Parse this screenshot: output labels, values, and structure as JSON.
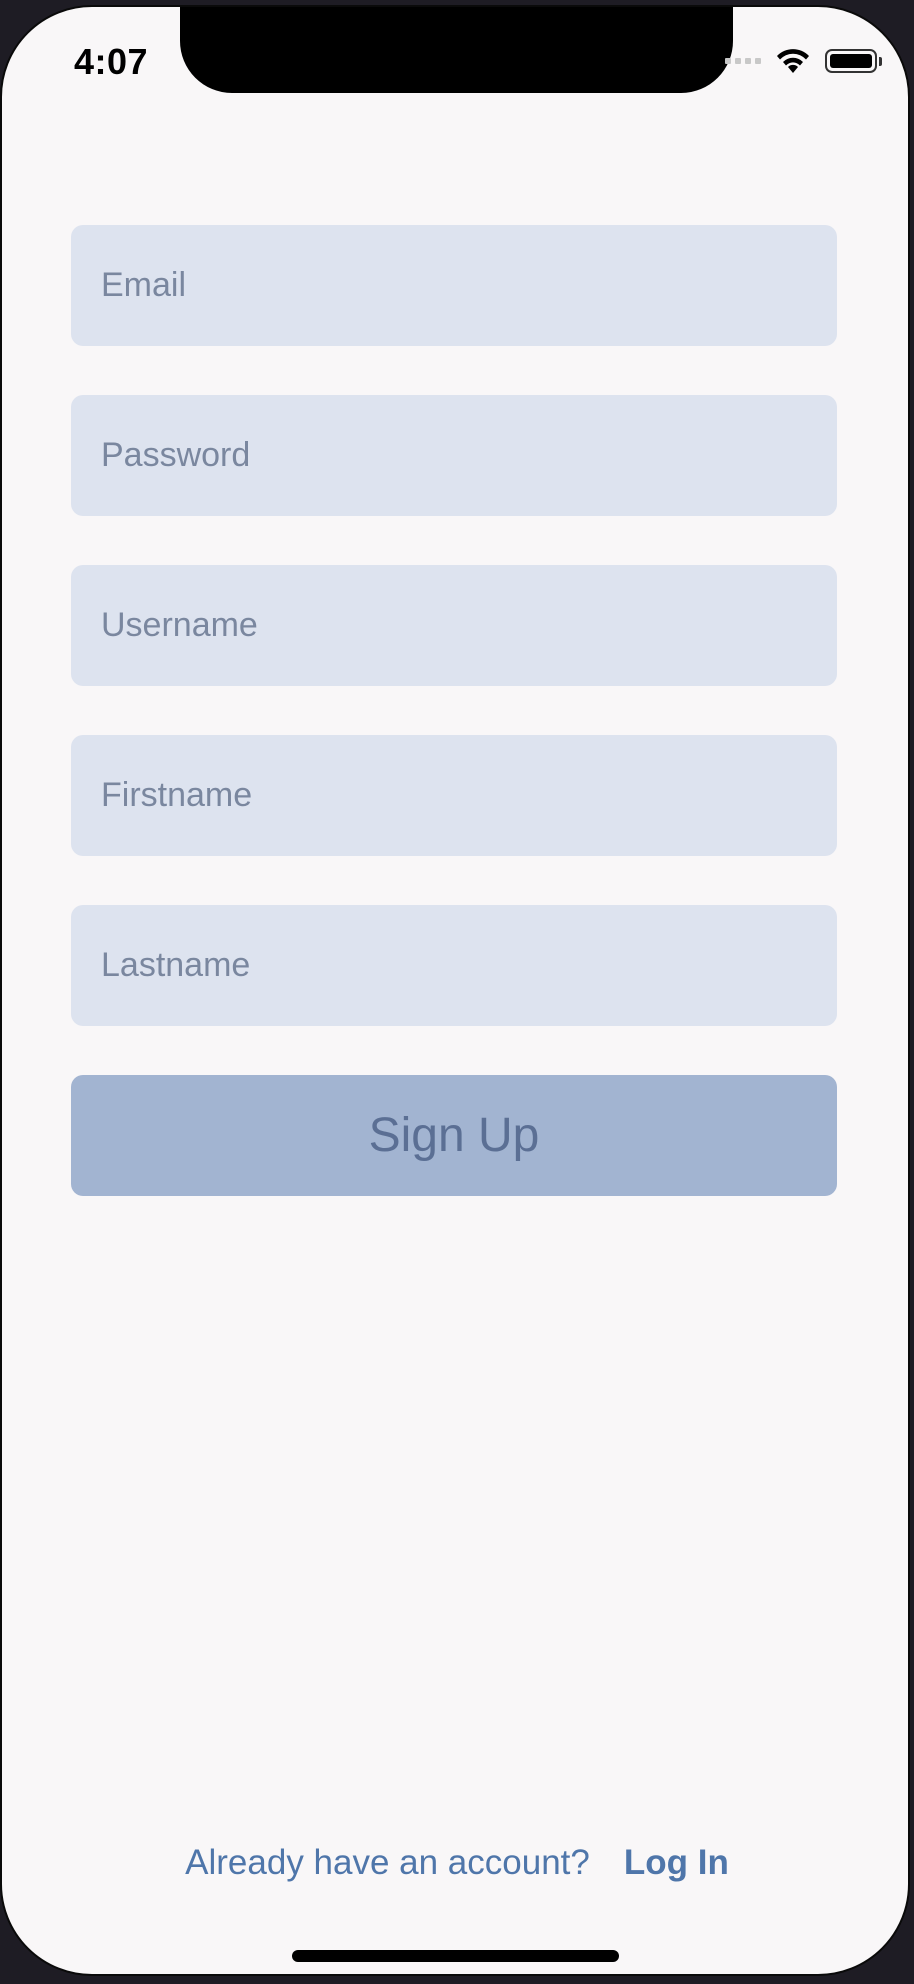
{
  "status_bar": {
    "time": "4:07"
  },
  "form": {
    "fields": [
      {
        "placeholder": "Email",
        "value": ""
      },
      {
        "placeholder": "Password",
        "value": ""
      },
      {
        "placeholder": "Username",
        "value": ""
      },
      {
        "placeholder": "Firstname",
        "value": ""
      },
      {
        "placeholder": "Lastname",
        "value": ""
      }
    ],
    "signup_label": "Sign Up"
  },
  "footer": {
    "prompt": "Already have an account?",
    "login_label": "Log In"
  },
  "colors": {
    "background": "#f9f7f8",
    "field_background": "#dde3ef",
    "button_background": "#a2b4d1",
    "accent": "#4f76aa"
  }
}
